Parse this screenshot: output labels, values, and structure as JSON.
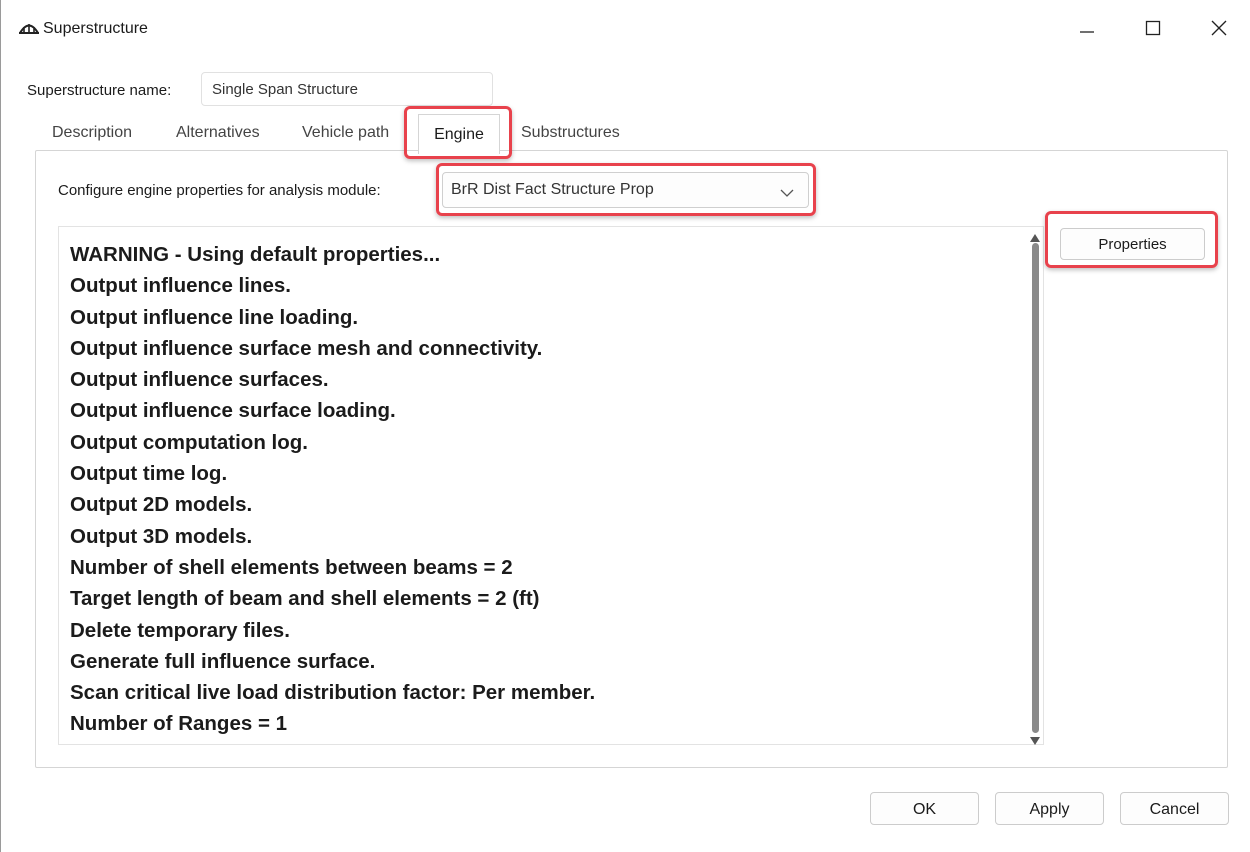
{
  "window": {
    "title": "Superstructure",
    "app_icon": "bridge-arch-icon",
    "controls": {
      "minimize": "minimize-icon",
      "maximize": "maximize-icon",
      "close": "close-icon"
    }
  },
  "superstructure": {
    "name_label": "Superstructure name:",
    "name_value": "Single Span Structure"
  },
  "tabs": [
    {
      "label": "Description",
      "active": false
    },
    {
      "label": "Alternatives",
      "active": false
    },
    {
      "label": "Vehicle path",
      "active": false
    },
    {
      "label": "Engine",
      "active": true
    },
    {
      "label": "Substructures",
      "active": false
    }
  ],
  "engine": {
    "configure_label": "Configure engine properties for analysis module:",
    "module_selected": "BrR Dist Fact Structure Prop",
    "properties_button": "Properties",
    "output_lines": [
      "WARNING - Using default properties...",
      "Output influence lines.",
      "Output influence line loading.",
      "Output influence surface mesh and connectivity.",
      "Output influence surfaces.",
      "Output influence surface loading.",
      "Output computation log.",
      "Output time log.",
      "Output 2D models.",
      "Output 3D models.",
      "Number of shell elements between beams = 2",
      "Target length of beam and shell elements = 2 (ft)",
      "Delete temporary files.",
      "Generate full influence surface.",
      "Scan critical live load distribution factor: Per member.",
      "Number of Ranges = 1"
    ]
  },
  "footer": {
    "ok": "OK",
    "apply": "Apply",
    "cancel": "Cancel"
  },
  "colors": {
    "highlight": "#e8424c",
    "scrollbar": "#8a8a8a"
  }
}
